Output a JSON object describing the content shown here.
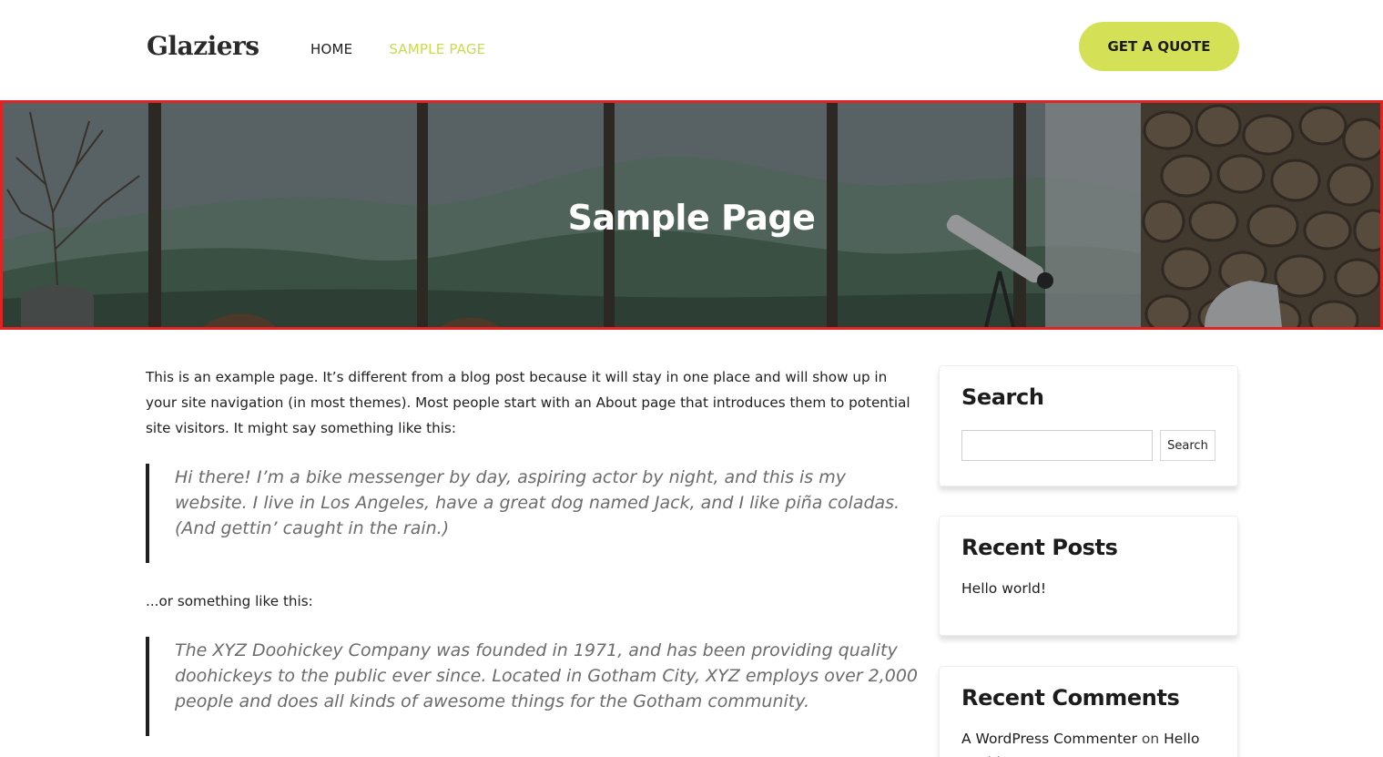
{
  "header": {
    "logo": "Glaziers",
    "nav": [
      {
        "label": "HOME",
        "active": false
      },
      {
        "label": "SAMPLE PAGE",
        "active": true
      }
    ],
    "cta_label": "GET A QUOTE",
    "accent_color": "#d4e157"
  },
  "hero": {
    "title": "Sample Page"
  },
  "main": {
    "intro": "This is an example page. It’s different from a blog post because it will stay in one place and will show up in your site navigation (in most themes). Most people start with an About page that introduces them to potential site visitors. It might say something like this:",
    "quote1": "Hi there! I’m a bike messenger by day, aspiring actor by night, and this is my website. I live in Los Angeles, have a great dog named Jack, and I like piña coladas. (And gettin’ caught in the rain.)",
    "middle": "...or something like this:",
    "quote2": "The XYZ Doohickey Company was founded in 1971, and has been providing quality doohickeys to the public ever since. Located in Gotham City, XYZ employs over 2,000 people and does all kinds of awesome things for the Gotham community."
  },
  "sidebar": {
    "search": {
      "title": "Search",
      "button_label": "Search",
      "input_value": ""
    },
    "recent_posts": {
      "title": "Recent Posts",
      "items": [
        "Hello world!"
      ]
    },
    "recent_comments": {
      "title": "Recent Comments",
      "author": "A WordPress Commenter",
      "on": "on",
      "post": "Hello world!"
    }
  }
}
